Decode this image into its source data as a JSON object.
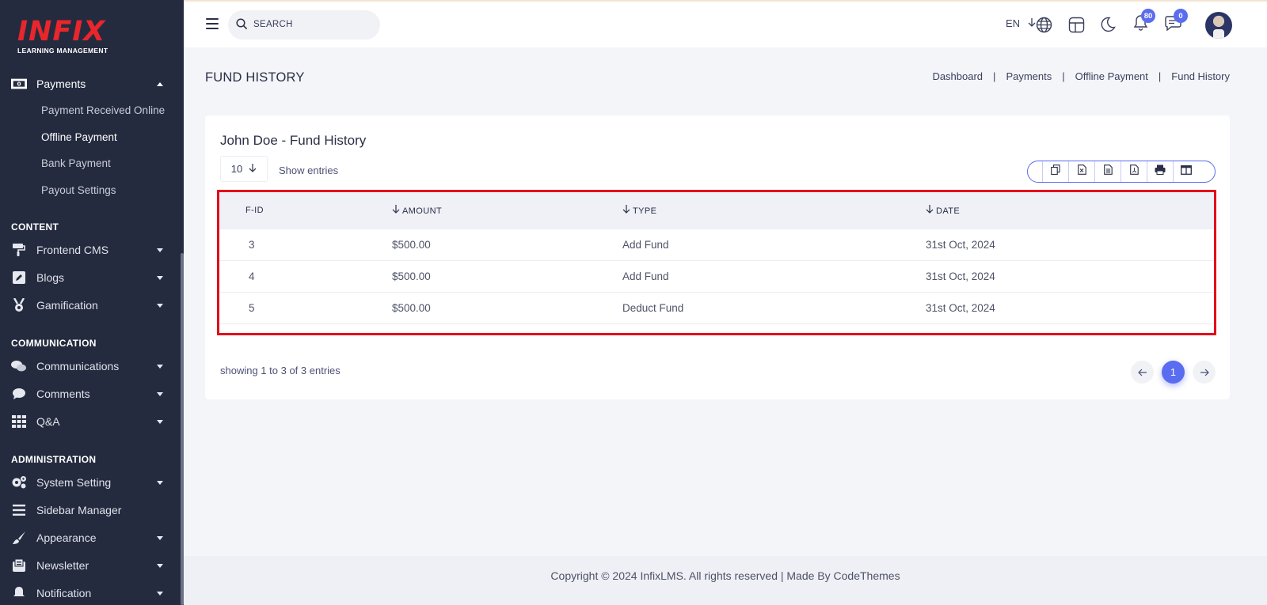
{
  "brand": {
    "name": "INFIX",
    "tagline": "LEARNING MANAGEMENT",
    "color": "#e8262c"
  },
  "sidebar": {
    "payments": {
      "label": "Payments",
      "icon": "money-icon"
    },
    "payment_subitems": [
      {
        "label": "Payment Received Online"
      },
      {
        "label": "Offline Payment",
        "active": true
      },
      {
        "label": "Bank Payment"
      },
      {
        "label": "Payout Settings"
      }
    ],
    "sections": {
      "content": "CONTENT",
      "communication": "COMMUNICATION",
      "administration": "ADMINISTRATION"
    },
    "content_items": [
      {
        "label": "Frontend CMS",
        "icon": "paint-roller-icon"
      },
      {
        "label": "Blogs",
        "icon": "edit-icon"
      },
      {
        "label": "Gamification",
        "icon": "medal-icon"
      }
    ],
    "communication_items": [
      {
        "label": "Communications",
        "icon": "chat-bubbles-icon"
      },
      {
        "label": "Comments",
        "icon": "comment-icon"
      },
      {
        "label": "Q&A",
        "icon": "grid-icon"
      }
    ],
    "administration_items": [
      {
        "label": "System Setting",
        "icon": "gears-icon"
      },
      {
        "label": "Sidebar Manager",
        "icon": "bars-icon"
      },
      {
        "label": "Appearance",
        "icon": "brush-icon"
      },
      {
        "label": "Newsletter",
        "icon": "newsletter-icon"
      },
      {
        "label": "Notification",
        "icon": "bell-icon"
      }
    ]
  },
  "header": {
    "search_placeholder": "SEARCH",
    "language": "EN",
    "notifications_count": "80",
    "messages_count": "0",
    "accent": "#5a6cf0"
  },
  "page": {
    "title": "FUND HISTORY",
    "breadcrumb": [
      "Dashboard",
      "Payments",
      "Offline Payment",
      "Fund History"
    ]
  },
  "card": {
    "title": "John Doe - Fund History",
    "entries_value": "10",
    "entries_label": "Show entries",
    "table": {
      "headers": [
        "F-ID",
        "AMOUNT",
        "TYPE",
        "DATE"
      ],
      "rows": [
        [
          "3",
          "$500.00",
          "Add Fund",
          "31st Oct, 2024"
        ],
        [
          "4",
          "$500.00",
          "Add Fund",
          "31st Oct, 2024"
        ],
        [
          "5",
          "$500.00",
          "Deduct Fund",
          "31st Oct, 2024"
        ]
      ]
    },
    "showing": "showing 1 to 3 of 3 entries",
    "current_page": "1"
  },
  "footer": {
    "text": "Copyright © 2024 InfixLMS. All rights reserved | Made By CodeThemes"
  }
}
